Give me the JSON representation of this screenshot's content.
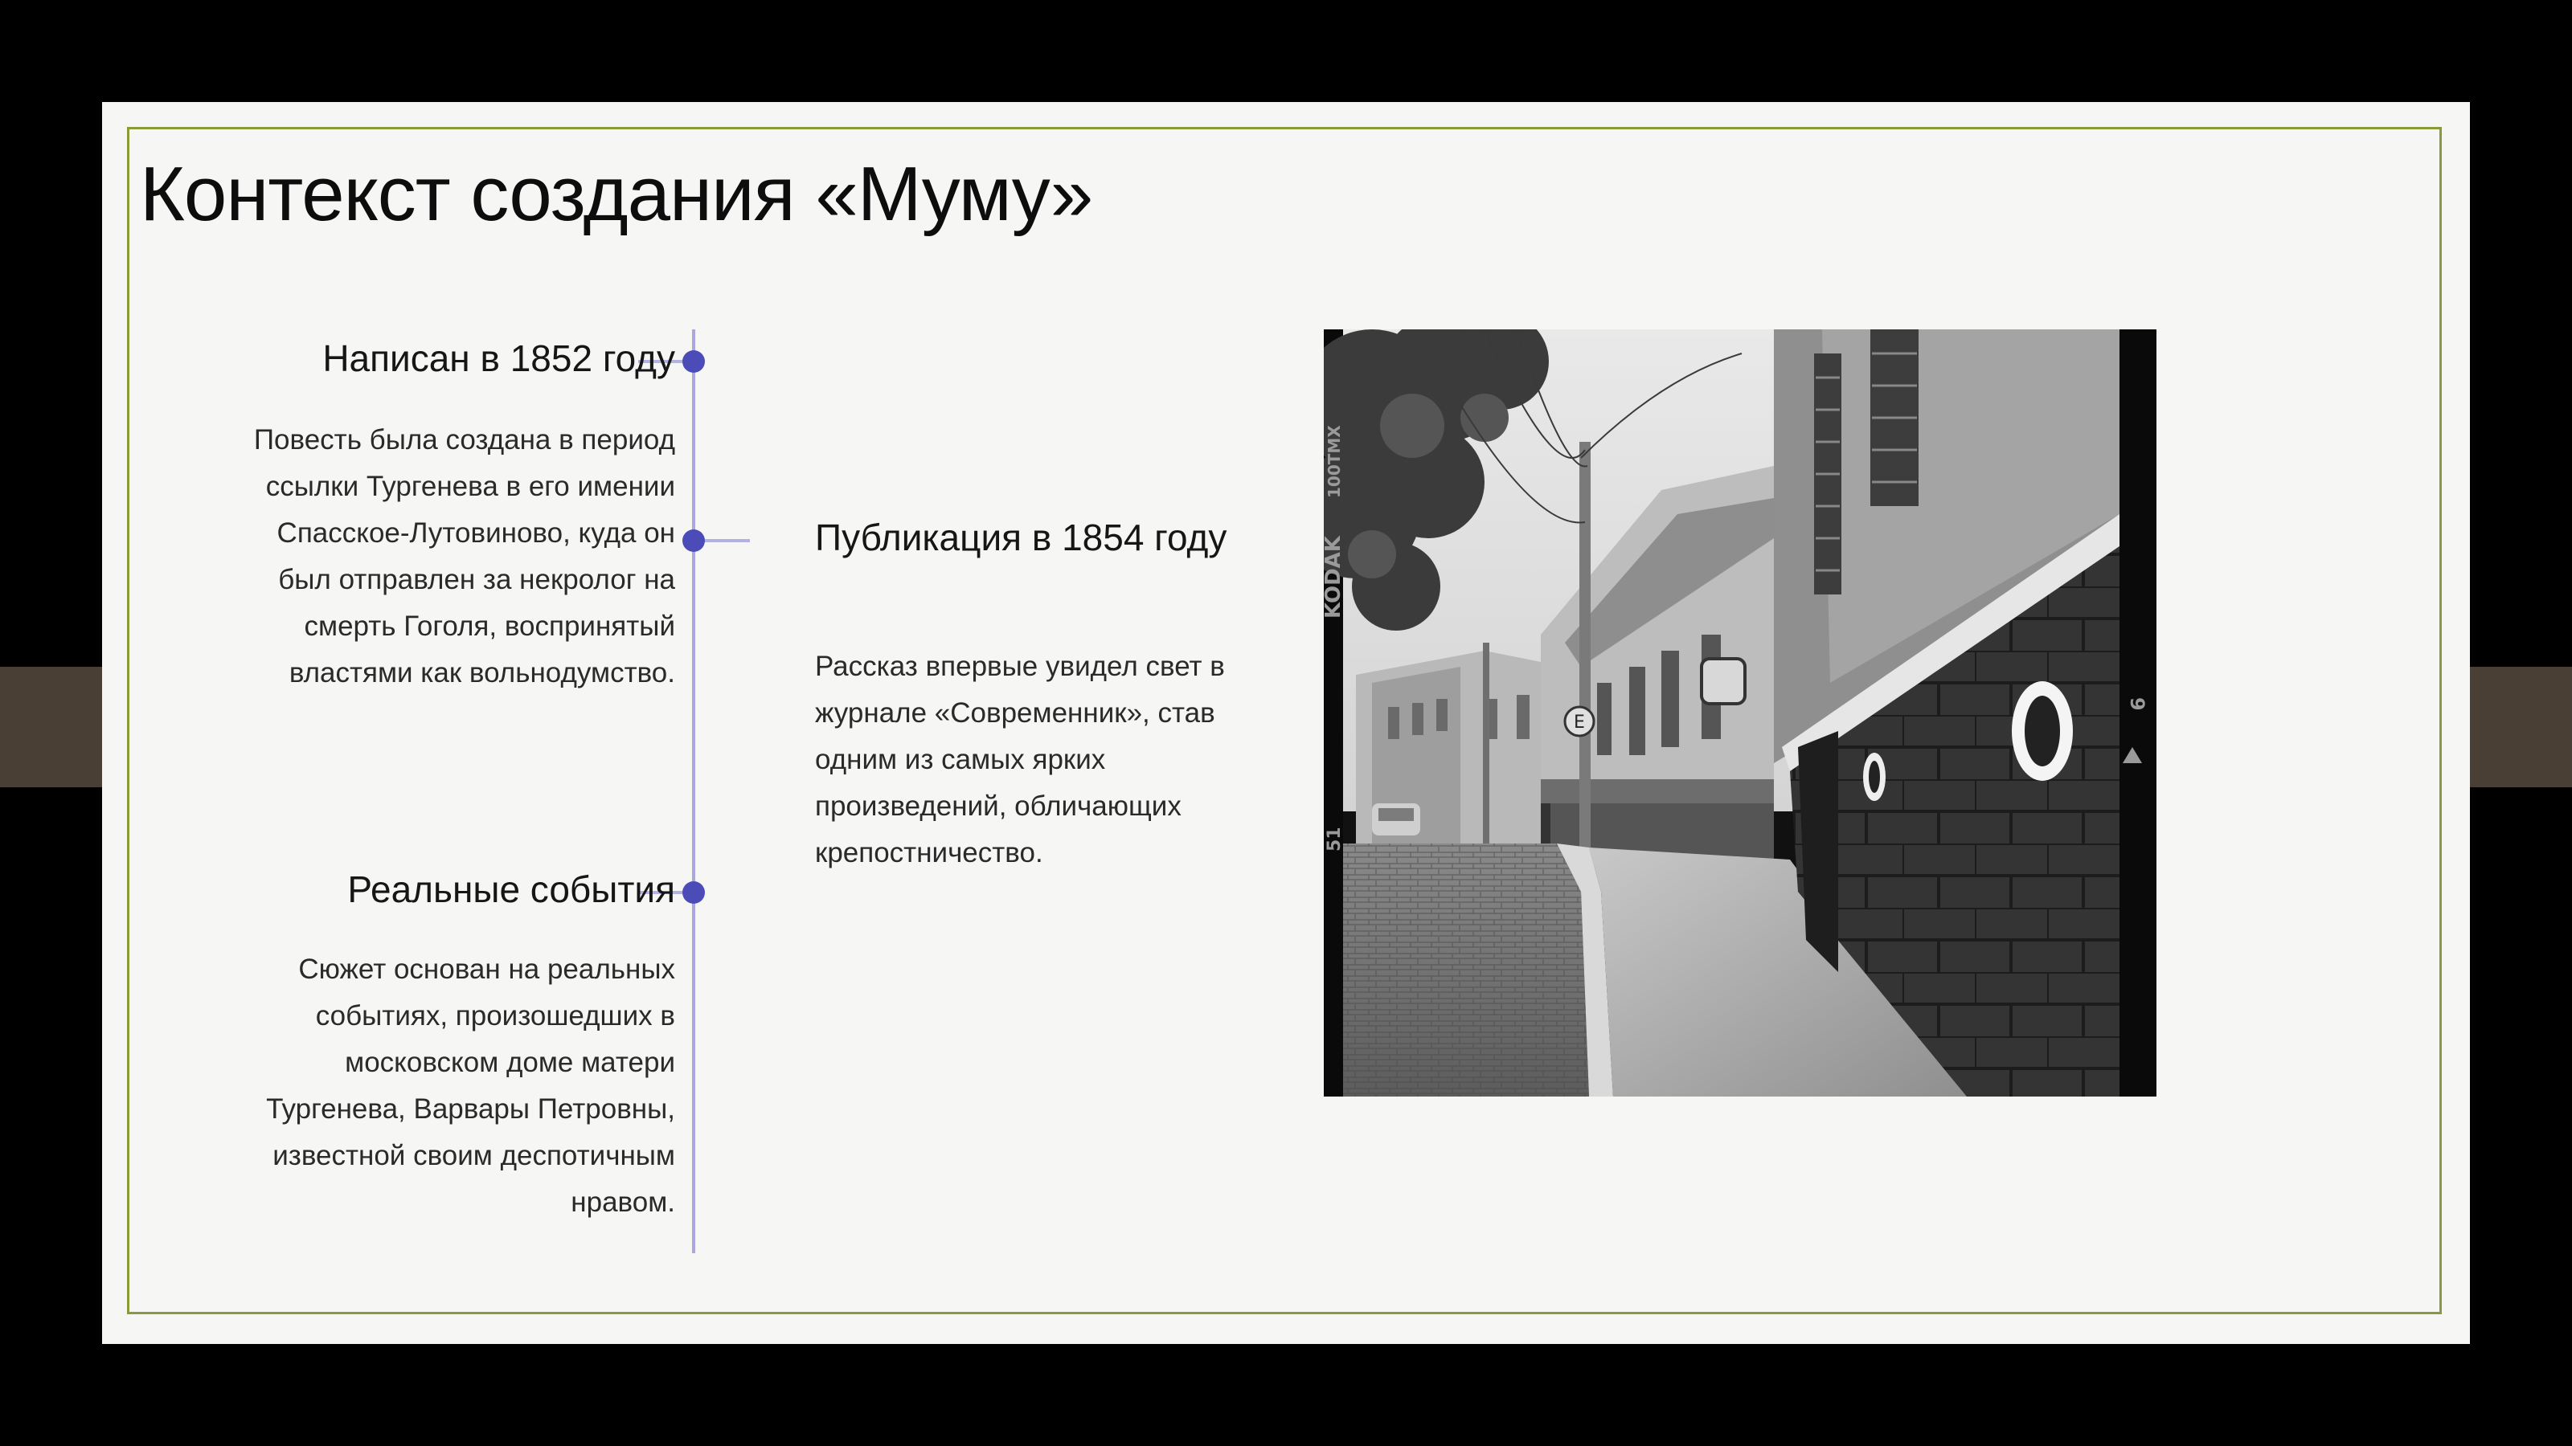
{
  "slide": {
    "title": "Контекст создания «Муму»"
  },
  "timeline": [
    {
      "heading": "Написан в 1852 году",
      "text": "Повесть была создана в период ссылки Тургенева в его имении Спасское-Лутовиново, куда он был отправлен за некролог на смерть Гоголя, воспринятый властями как вольнодумство."
    },
    {
      "heading": "Публикация в 1854 году",
      "text": "Рассказ впервые увидел свет в журнале «Современник», став одним из самых ярких произведений, обличающих крепостничество."
    },
    {
      "heading": "Реальные события",
      "text": "Сюжет основан на реальных событиях, произошедших в московском доме матери Тургенева, Варвары Петровны, известной своим деспотичным нравом."
    }
  ],
  "photo": {
    "film_edge_brand": "KODAK",
    "film_edge_code": "100TMX",
    "film_edge_frame_left": "51",
    "film_edge_frame_right": "9",
    "sign_letter": "E"
  },
  "colors": {
    "frame_border": "#8a9a3a",
    "timeline_dot": "#4b4cb8",
    "timeline_line": "#a9a7dc",
    "side_tab": "#4a3f34"
  }
}
